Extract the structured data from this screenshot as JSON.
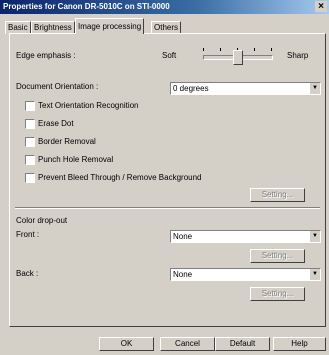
{
  "window": {
    "title": "Properties for Canon DR-5010C on STI-0000",
    "close_glyph": "×"
  },
  "tabs": [
    {
      "label": "Basic"
    },
    {
      "label": "Brightness"
    },
    {
      "label": "Image processing",
      "active": true
    },
    {
      "label": "Others"
    }
  ],
  "edge_emphasis": {
    "label": "Edge emphasis :",
    "soft_label": "Soft",
    "sharp_label": "Sharp"
  },
  "document_orientation": {
    "label": "Document Orientation :",
    "value": "0 degrees"
  },
  "options": [
    {
      "label": "Text Orientation Recognition",
      "checked": false
    },
    {
      "label": "Erase Dot",
      "checked": false
    },
    {
      "label": "Border Removal",
      "checked": false
    },
    {
      "label": "Punch Hole Removal",
      "checked": false
    },
    {
      "label": "Prevent Bleed Through / Remove Background",
      "checked": false
    }
  ],
  "settings_label": "Setting...",
  "color_dropout": {
    "heading": "Color drop-out",
    "front_label": "Front :",
    "front_value": "None",
    "back_label": "Back :",
    "back_value": "None"
  },
  "footer": {
    "ok": "OK",
    "cancel": "Cancel",
    "default": "Default",
    "help": "Help"
  },
  "colors": {
    "face": "#d4d0c8",
    "title_start": "#0a246a",
    "disabled_text": "#808080"
  }
}
